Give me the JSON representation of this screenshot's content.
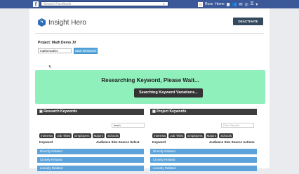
{
  "facebook": {
    "logo": "f",
    "search_placeholder": "Search Facebook",
    "user": "Ross",
    "home": "Home",
    "notif_count": "1"
  },
  "app": {
    "name": "Insight Hero",
    "deactivate_label": "DEACTIVATE",
    "project_label": "Project: Math Demo JV",
    "keyword_value": "mathematics",
    "start_label": "Start Research"
  },
  "status": {
    "title": "Researching Keyword, Please Wait...",
    "button": "Searching Keyword Variations..."
  },
  "research": {
    "title": "Research Keywords",
    "filter_value": "teach",
    "chips": [
      "Interests",
      "Job Titles",
      "Employers",
      "Majors",
      "Schools"
    ],
    "col_keyword": "Keyword",
    "col_actions": "Audience Size  Source  Select",
    "rows": [
      "Directly Related",
      "Closely Related",
      "Loosely Related"
    ]
  },
  "project": {
    "title": "Project Keywords",
    "filter_placeholder": "Filter Results",
    "chips": [
      "Interests",
      "Job Titles",
      "Employers",
      "Majors",
      "Schools"
    ],
    "col_keyword": "Keyword",
    "col_actions": "Audience Size  Source  Actions",
    "rows": [
      "Directly Related",
      "Closely Related",
      "Loosely Related"
    ]
  }
}
